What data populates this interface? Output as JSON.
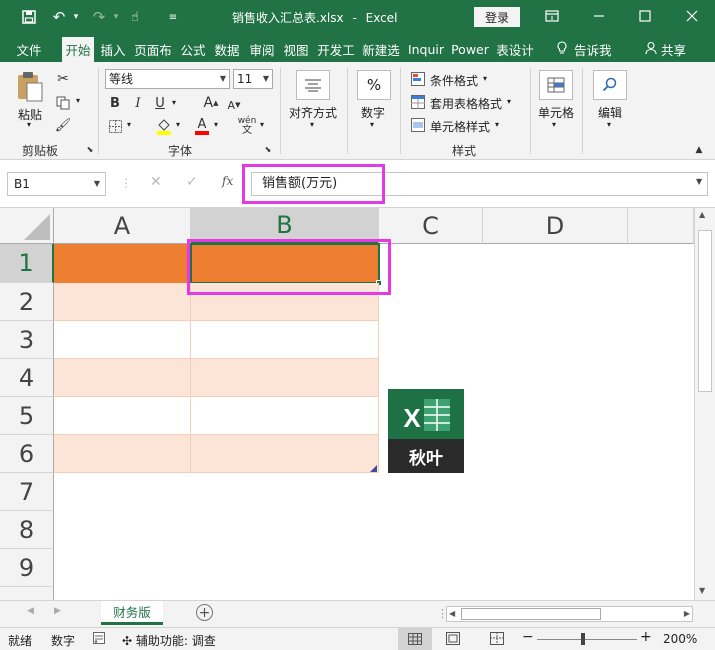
{
  "title_bar": {
    "filename": "销售收入汇总表.xlsx",
    "app": "Excel",
    "separator": "-",
    "login_label": "登录"
  },
  "tabs": [
    "文件",
    "开始",
    "插入",
    "页面布",
    "公式",
    "数据",
    "审阅",
    "视图",
    "开发工",
    "新建选",
    "Inquir",
    "Power",
    "表设计"
  ],
  "tell_me": "告诉我",
  "share": "共享",
  "ribbon": {
    "paste": "粘贴",
    "clipboard": "剪贴板",
    "font_name": "等线",
    "font_size": "11",
    "font_group": "字体",
    "bold": "B",
    "italic": "I",
    "underline": "U",
    "grow": "A",
    "shrink": "A",
    "color_a": "A",
    "phonetic": "wén",
    "alignment": "对齐方式",
    "number": "数字",
    "number_symbol": "%",
    "conditional": "条件格式",
    "table_format": "套用表格格式",
    "cell_style": "单元格样式",
    "styles_group": "样式",
    "cells": "单元格",
    "editing": "编辑"
  },
  "formula_bar": {
    "name_box": "B1",
    "fx": "fx",
    "value": "销售额(万元)"
  },
  "columns": [
    "A",
    "B",
    "C",
    "D"
  ],
  "rows": [
    "1",
    "2",
    "3",
    "4",
    "5",
    "6",
    "7",
    "8",
    "9"
  ],
  "logo": {
    "label": "秋叶",
    "letter": "X"
  },
  "sheet_tab": "财务版",
  "status": {
    "ready": "就绪",
    "numeric": "数字",
    "accessibility": "辅助功能: 调查",
    "zoom": "200%"
  },
  "colors": {
    "excel_green": "#217346",
    "header_orange": "#ed7d31",
    "band_light": "#fce4d6",
    "highlight": "#e43ae4"
  }
}
